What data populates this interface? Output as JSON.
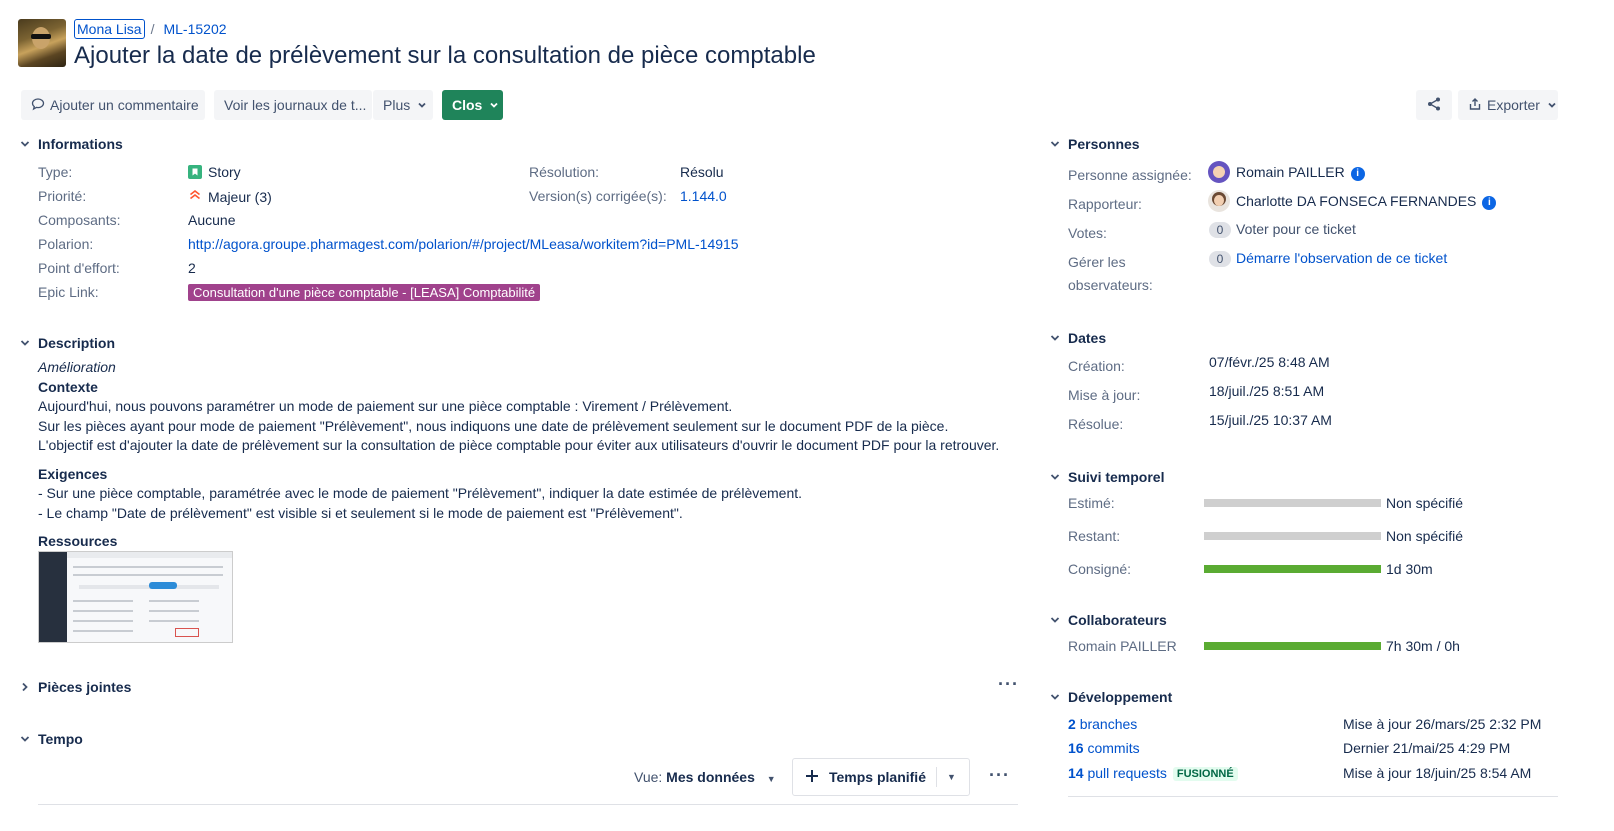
{
  "header": {
    "project": "Mona Lisa",
    "issue_key": "ML-15202",
    "title": "Ajouter la date de prélèvement sur la consultation de pièce comptable"
  },
  "toolbar": {
    "comment": "Ajouter un commentaire",
    "logs": "Voir les journaux de t...",
    "more": "Plus",
    "status": "Clos",
    "export": "Exporter",
    "status_color": "#1f845a"
  },
  "informations": {
    "heading": "Informations",
    "type_label": "Type:",
    "type_value": "Story",
    "priority_label": "Priorité:",
    "priority_value": "Majeur (3)",
    "components_label": "Composants:",
    "components_value": "Aucune",
    "polarion_label": "Polarion:",
    "polarion_value": "http://agora.groupe.pharmagest.com/polarion/#/project/MLeasa/workitem?id=PML-14915",
    "effort_label": "Point d'effort:",
    "effort_value": "2",
    "epic_label": "Epic Link:",
    "epic_value": "Consultation d'une pièce comptable - [LEASA] Comptabilité",
    "resolution_label": "Résolution:",
    "resolution_value": "Résolu",
    "version_label": "Version(s) corrigée(s):",
    "version_value": "1.144.0"
  },
  "description": {
    "heading": "Description",
    "kind": "Amélioration",
    "context_title": "Contexte",
    "context_lines": [
      "Aujourd'hui, nous pouvons paramétrer un mode de paiement sur une pièce comptable : Virement / Prélèvement.",
      "Sur les pièces ayant pour mode de paiement \"Prélèvement\", nous indiquons une date de prélèvement seulement sur le document PDF de la pièce.",
      "L'objectif est d'ajouter la date de prélèvement sur la consultation de pièce comptable pour éviter aux utilisateurs d'ouvrir le document PDF pour la retrouver."
    ],
    "requirements_title": "Exigences",
    "requirements_lines": [
      "- Sur une pièce comptable, paramétrée avec le mode de paiement \"Prélèvement\", indiquer la date estimée de prélèvement.",
      "- Le champ \"Date de prélèvement\" est visible si et seulement si le mode de paiement est \"Prélèvement\"."
    ],
    "resources_title": "Ressources"
  },
  "attachments": {
    "heading": "Pièces jointes"
  },
  "tempo": {
    "heading": "Tempo",
    "view_label": "Vue:",
    "view_value": "Mes données",
    "planned_button": "Temps planifié"
  },
  "people": {
    "heading": "Personnes",
    "assignee_label": "Personne assignée:",
    "assignee": "Romain PAILLER",
    "reporter_label": "Rapporteur:",
    "reporter": "Charlotte DA FONSECA FERNANDES",
    "votes_label": "Votes:",
    "votes_count": "0",
    "votes_action": "Voter pour ce ticket",
    "watchers_label_1": "Gérer les",
    "watchers_label_2": "observateurs:",
    "watchers_count": "0",
    "watchers_action": "Démarre l'observation de ce ticket"
  },
  "dates": {
    "heading": "Dates",
    "created_label": "Création:",
    "created": "07/févr./25 8:48 AM",
    "updated_label": "Mise à jour:",
    "updated": "18/juil./25 8:51 AM",
    "resolved_label": "Résolue:",
    "resolved": "15/juil./25 10:37 AM"
  },
  "time_tracking": {
    "heading": "Suivi temporel",
    "estimated_label": "Estimé:",
    "estimated": "Non spécifié",
    "estimated_fill": 1,
    "remaining_label": "Restant:",
    "remaining": "Non spécifié",
    "remaining_fill": 1,
    "logged_label": "Consigné:",
    "logged": "1d 30m",
    "logged_fill": 1
  },
  "collaborators": {
    "heading": "Collaborateurs",
    "name": "Romain PAILLER",
    "value": "7h 30m / 0h",
    "fill": 1
  },
  "development": {
    "heading": "Développement",
    "branches_count": "2",
    "branches_label": "branches",
    "branches_meta": "Mise à jour 26/mars/25 2:32 PM",
    "commits_count": "16",
    "commits_label": "commits",
    "commits_meta": "Dernier 21/mai/25 4:29 PM",
    "prs_count": "14",
    "prs_label": "pull requests",
    "prs_status": "FUSIONNÉ",
    "prs_meta": "Mise à jour 18/juin/25 8:54 AM"
  }
}
